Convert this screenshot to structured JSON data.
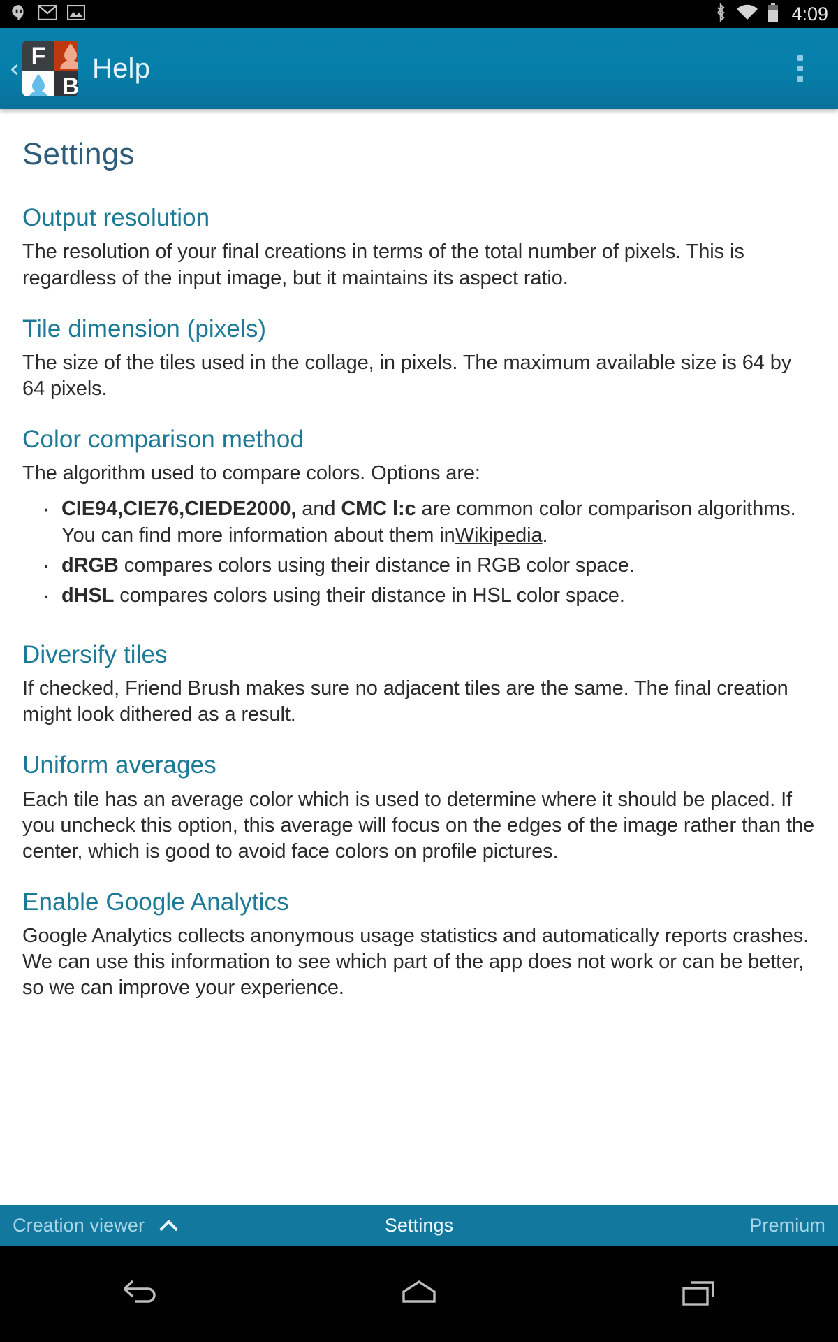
{
  "statusbar": {
    "time": "4:09",
    "icons": [
      {
        "name": "hangouts-icon"
      },
      {
        "name": "gmail-icon"
      },
      {
        "name": "photo-icon"
      },
      {
        "name": "bluetooth-icon"
      },
      {
        "name": "wifi-icon"
      },
      {
        "name": "battery-icon"
      }
    ]
  },
  "appbar": {
    "back_label": "‹",
    "title": "Help",
    "logo": {
      "letter_top_left": "F",
      "letter_bottom_right": "B"
    },
    "accent_color": "#0b7fab"
  },
  "content": {
    "page_title": "Settings",
    "sections": [
      {
        "title": "Output resolution",
        "body": "The resolution of your final creations in terms of the total number of pixels. This is regardless of the input image, but it maintains its aspect ratio."
      },
      {
        "title": "Tile dimension (pixels)",
        "body": "The size of the tiles used in the collage, in pixels. The maximum available size is 64 by 64 pixels."
      },
      {
        "title": "Color comparison method",
        "body": "The algorithm used to compare colors. Options are:"
      },
      {
        "title": "Diversify tiles",
        "body": "If checked, Friend Brush makes sure no adjacent tiles are the same. The final creation might look dithered as a result."
      },
      {
        "title": "Uniform averages",
        "body": "Each tile has an average color which is used to determine where it should be placed. If you uncheck this option, this average will focus on the edges of the image rather than the center, which is good to avoid face colors on profile pictures."
      },
      {
        "title": "Enable Google Analytics",
        "body": "Google Analytics collects anonymous usage statistics and automatically reports crashes. We can use this information to see which part of the app does not work or can be better, so we can improve your experience."
      }
    ],
    "color_options": [
      {
        "bold_lead": "CIE94,CIE76,CIEDE2000,",
        "mid": " and ",
        "bold_second": "CMC l:c",
        "tail": " are common color comparison algorithms. You can find more information about them in",
        "link": "Wikipedia",
        "after_link": "."
      },
      {
        "bold_lead": "dRGB",
        "tail": " compares colors using their distance in RGB color space."
      },
      {
        "bold_lead": "dHSL",
        "tail": " compares colors using their distance in HSL color space."
      }
    ]
  },
  "bottombar": {
    "left_label": "Creation viewer",
    "center_label": "Settings",
    "right_label": "Premium"
  },
  "navbar": {
    "back": "back-icon",
    "home": "home-icon",
    "recents": "recents-icon"
  }
}
